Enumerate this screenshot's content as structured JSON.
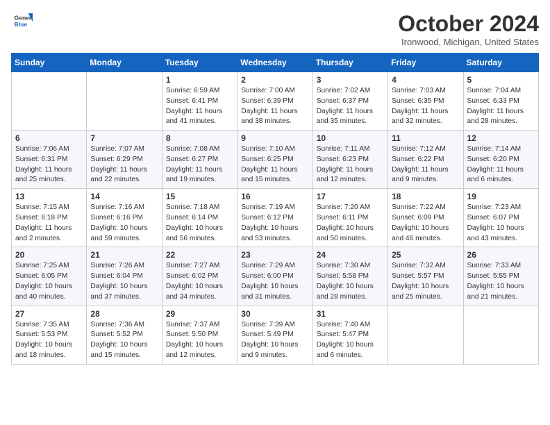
{
  "header": {
    "logo": {
      "general": "General",
      "blue": "Blue"
    },
    "title": "October 2024",
    "location": "Ironwood, Michigan, United States"
  },
  "weekdays": [
    "Sunday",
    "Monday",
    "Tuesday",
    "Wednesday",
    "Thursday",
    "Friday",
    "Saturday"
  ],
  "weeks": [
    [
      null,
      null,
      {
        "day": "1",
        "sunrise": "Sunrise: 6:59 AM",
        "sunset": "Sunset: 6:41 PM",
        "daylight": "Daylight: 11 hours and 41 minutes."
      },
      {
        "day": "2",
        "sunrise": "Sunrise: 7:00 AM",
        "sunset": "Sunset: 6:39 PM",
        "daylight": "Daylight: 11 hours and 38 minutes."
      },
      {
        "day": "3",
        "sunrise": "Sunrise: 7:02 AM",
        "sunset": "Sunset: 6:37 PM",
        "daylight": "Daylight: 11 hours and 35 minutes."
      },
      {
        "day": "4",
        "sunrise": "Sunrise: 7:03 AM",
        "sunset": "Sunset: 6:35 PM",
        "daylight": "Daylight: 11 hours and 32 minutes."
      },
      {
        "day": "5",
        "sunrise": "Sunrise: 7:04 AM",
        "sunset": "Sunset: 6:33 PM",
        "daylight": "Daylight: 11 hours and 28 minutes."
      }
    ],
    [
      {
        "day": "6",
        "sunrise": "Sunrise: 7:06 AM",
        "sunset": "Sunset: 6:31 PM",
        "daylight": "Daylight: 11 hours and 25 minutes."
      },
      {
        "day": "7",
        "sunrise": "Sunrise: 7:07 AM",
        "sunset": "Sunset: 6:29 PM",
        "daylight": "Daylight: 11 hours and 22 minutes."
      },
      {
        "day": "8",
        "sunrise": "Sunrise: 7:08 AM",
        "sunset": "Sunset: 6:27 PM",
        "daylight": "Daylight: 11 hours and 19 minutes."
      },
      {
        "day": "9",
        "sunrise": "Sunrise: 7:10 AM",
        "sunset": "Sunset: 6:25 PM",
        "daylight": "Daylight: 11 hours and 15 minutes."
      },
      {
        "day": "10",
        "sunrise": "Sunrise: 7:11 AM",
        "sunset": "Sunset: 6:23 PM",
        "daylight": "Daylight: 11 hours and 12 minutes."
      },
      {
        "day": "11",
        "sunrise": "Sunrise: 7:12 AM",
        "sunset": "Sunset: 6:22 PM",
        "daylight": "Daylight: 11 hours and 9 minutes."
      },
      {
        "day": "12",
        "sunrise": "Sunrise: 7:14 AM",
        "sunset": "Sunset: 6:20 PM",
        "daylight": "Daylight: 11 hours and 6 minutes."
      }
    ],
    [
      {
        "day": "13",
        "sunrise": "Sunrise: 7:15 AM",
        "sunset": "Sunset: 6:18 PM",
        "daylight": "Daylight: 11 hours and 2 minutes."
      },
      {
        "day": "14",
        "sunrise": "Sunrise: 7:16 AM",
        "sunset": "Sunset: 6:16 PM",
        "daylight": "Daylight: 10 hours and 59 minutes."
      },
      {
        "day": "15",
        "sunrise": "Sunrise: 7:18 AM",
        "sunset": "Sunset: 6:14 PM",
        "daylight": "Daylight: 10 hours and 56 minutes."
      },
      {
        "day": "16",
        "sunrise": "Sunrise: 7:19 AM",
        "sunset": "Sunset: 6:12 PM",
        "daylight": "Daylight: 10 hours and 53 minutes."
      },
      {
        "day": "17",
        "sunrise": "Sunrise: 7:20 AM",
        "sunset": "Sunset: 6:11 PM",
        "daylight": "Daylight: 10 hours and 50 minutes."
      },
      {
        "day": "18",
        "sunrise": "Sunrise: 7:22 AM",
        "sunset": "Sunset: 6:09 PM",
        "daylight": "Daylight: 10 hours and 46 minutes."
      },
      {
        "day": "19",
        "sunrise": "Sunrise: 7:23 AM",
        "sunset": "Sunset: 6:07 PM",
        "daylight": "Daylight: 10 hours and 43 minutes."
      }
    ],
    [
      {
        "day": "20",
        "sunrise": "Sunrise: 7:25 AM",
        "sunset": "Sunset: 6:05 PM",
        "daylight": "Daylight: 10 hours and 40 minutes."
      },
      {
        "day": "21",
        "sunrise": "Sunrise: 7:26 AM",
        "sunset": "Sunset: 6:04 PM",
        "daylight": "Daylight: 10 hours and 37 minutes."
      },
      {
        "day": "22",
        "sunrise": "Sunrise: 7:27 AM",
        "sunset": "Sunset: 6:02 PM",
        "daylight": "Daylight: 10 hours and 34 minutes."
      },
      {
        "day": "23",
        "sunrise": "Sunrise: 7:29 AM",
        "sunset": "Sunset: 6:00 PM",
        "daylight": "Daylight: 10 hours and 31 minutes."
      },
      {
        "day": "24",
        "sunrise": "Sunrise: 7:30 AM",
        "sunset": "Sunset: 5:58 PM",
        "daylight": "Daylight: 10 hours and 28 minutes."
      },
      {
        "day": "25",
        "sunrise": "Sunrise: 7:32 AM",
        "sunset": "Sunset: 5:57 PM",
        "daylight": "Daylight: 10 hours and 25 minutes."
      },
      {
        "day": "26",
        "sunrise": "Sunrise: 7:33 AM",
        "sunset": "Sunset: 5:55 PM",
        "daylight": "Daylight: 10 hours and 21 minutes."
      }
    ],
    [
      {
        "day": "27",
        "sunrise": "Sunrise: 7:35 AM",
        "sunset": "Sunset: 5:53 PM",
        "daylight": "Daylight: 10 hours and 18 minutes."
      },
      {
        "day": "28",
        "sunrise": "Sunrise: 7:36 AM",
        "sunset": "Sunset: 5:52 PM",
        "daylight": "Daylight: 10 hours and 15 minutes."
      },
      {
        "day": "29",
        "sunrise": "Sunrise: 7:37 AM",
        "sunset": "Sunset: 5:50 PM",
        "daylight": "Daylight: 10 hours and 12 minutes."
      },
      {
        "day": "30",
        "sunrise": "Sunrise: 7:39 AM",
        "sunset": "Sunset: 5:49 PM",
        "daylight": "Daylight: 10 hours and 9 minutes."
      },
      {
        "day": "31",
        "sunrise": "Sunrise: 7:40 AM",
        "sunset": "Sunset: 5:47 PM",
        "daylight": "Daylight: 10 hours and 6 minutes."
      },
      null,
      null
    ]
  ]
}
